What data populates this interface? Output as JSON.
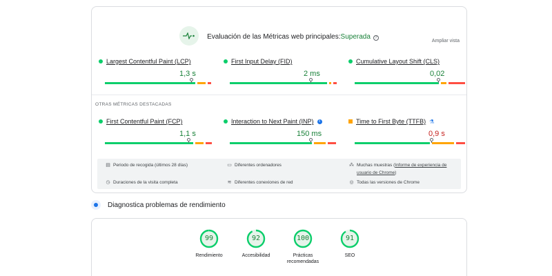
{
  "cwv": {
    "title": "Evaluación de las Métricas web principales:",
    "status": "Superada",
    "expand": "Ampliar vista",
    "section_other": "OTRAS MÉTRICAS DESTACADAS",
    "metrics": [
      {
        "label": "Largest Contentful Paint (LCP)",
        "value": "1,3 s",
        "rating": "good",
        "marker": 0.79,
        "segs": [
          0.84,
          0.09,
          0.03
        ]
      },
      {
        "label": "First Input Delay (FID)",
        "value": "2 ms",
        "rating": "good",
        "marker": 0.74,
        "segs": [
          0.9,
          0.04,
          0.03
        ]
      },
      {
        "label": "Cumulative Layout Shift (CLS)",
        "value": "0,02",
        "rating": "good",
        "marker": 0.76,
        "segs": [
          0.78,
          0.07,
          0.15
        ]
      },
      {
        "label": "First Contentful Paint (FCP)",
        "value": "1,1 s",
        "rating": "good",
        "marker": 0.76,
        "segs": [
          0.82,
          0.09,
          0.06
        ]
      },
      {
        "label": "Interaction to Next Paint (INP)",
        "value": "150 ms",
        "rating": "good",
        "marker": 0.74,
        "segs": [
          0.76,
          0.13,
          0.07
        ]
      },
      {
        "label": "Time to First Byte (TTFB)",
        "value": "0,9 s",
        "rating": "average",
        "marker": 0.7,
        "segs": [
          0.7,
          0.22,
          0.08
        ]
      }
    ],
    "info": {
      "period": "Periodo de recogida (últimos 28 días)",
      "devices": "Diferentes ordenadores",
      "samples_prefix": "Muchas muestras (",
      "samples_link": "Informe de experiencia de usuario de Chrome",
      "samples_suffix": ")",
      "duration": "Duraciones de la visita completa",
      "network": "Diferentes conexiones de red",
      "chrome": "Todas las versiones de Chrome"
    }
  },
  "diagnose": {
    "title": "Diagnostica problemas de rendimiento",
    "scores": [
      {
        "score": "99",
        "value": 99,
        "label": "Rendimiento"
      },
      {
        "score": "92",
        "value": 92,
        "label": "Accesibilidad"
      },
      {
        "score": "100",
        "value": 100,
        "label": "Prácticas recomendadas"
      },
      {
        "score": "91",
        "value": 91,
        "label": "SEO"
      }
    ]
  },
  "colors": {
    "good": "#0cce6b",
    "average": "#ffa400",
    "poor": "#ff4e42"
  }
}
